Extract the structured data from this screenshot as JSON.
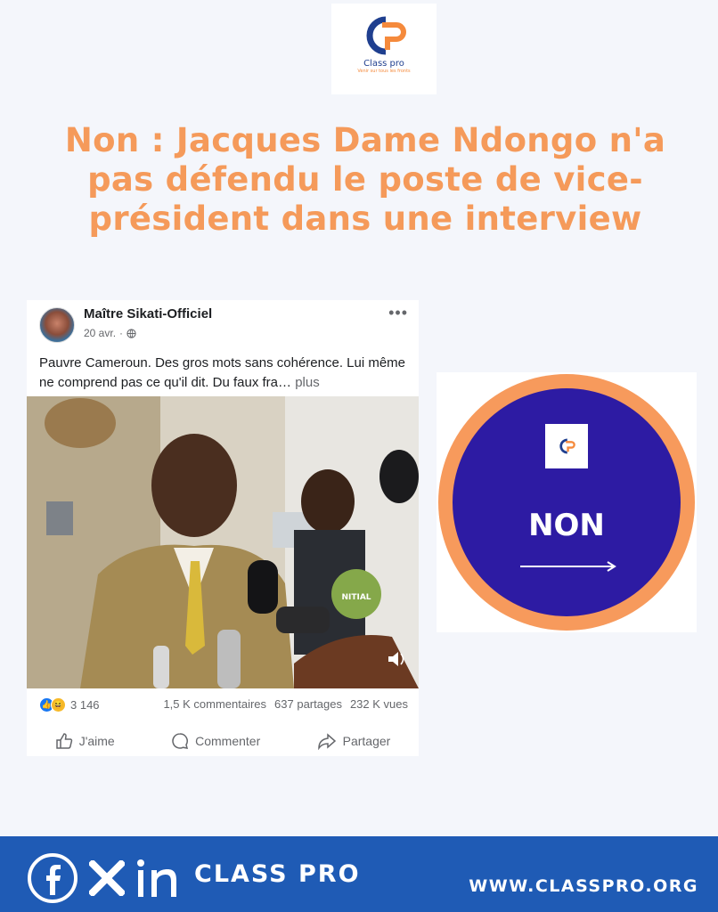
{
  "logo": {
    "name": "Class pro",
    "tagline": "Venir sur tous les fronts"
  },
  "headline": "Non : Jacques Dame Ndongo n'a pas défendu le poste de vice-président dans une interview",
  "post": {
    "author": "Maître Sikati-Officiel",
    "date": "20 avr.",
    "separator": "·",
    "more_icon": "•••",
    "text": "Pauvre Cameroun. Des gros mots sans cohérence. Lui même ne comprend pas ce qu'il dit. Du faux fra…",
    "more_link": "plus",
    "video_watermark": "NITIAL",
    "reaction_count": "3 146",
    "comments": "1,5 K commentaires",
    "shares": "637 partages",
    "views": "232 K vues",
    "actions": {
      "like": "J'aime",
      "comment": "Commenter",
      "share": "Partager"
    }
  },
  "verdict": {
    "label": "NON",
    "ring_color": "#f79a5c",
    "fill_color": "#2d1ba3"
  },
  "footer": {
    "brand": "CLASS PRO",
    "website": "WWW.CLASSPRO.ORG",
    "icons": [
      "facebook-icon",
      "x-icon",
      "linkedin-icon"
    ],
    "background": "#1f5bb5"
  },
  "accent": "#f59a5a"
}
